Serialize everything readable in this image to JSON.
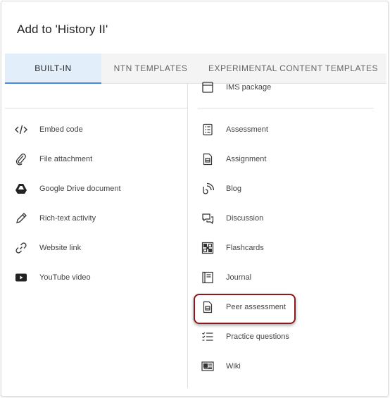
{
  "dialog": {
    "title": "Add to 'History II'"
  },
  "tabs": [
    {
      "label": "BUILT-IN",
      "active": true
    },
    {
      "label": "NTN TEMPLATES",
      "active": false
    },
    {
      "label": "EXPERIMENTAL CONTENT TEMPLATES",
      "active": false
    }
  ],
  "left_items": [
    {
      "label": "Embed code",
      "icon": "code-icon"
    },
    {
      "label": "File attachment",
      "icon": "paperclip-icon"
    },
    {
      "label": "Google Drive document",
      "icon": "google-drive-icon"
    },
    {
      "label": "Rich-text activity",
      "icon": "pencil-icon"
    },
    {
      "label": "Website link",
      "icon": "link-icon"
    },
    {
      "label": "YouTube video",
      "icon": "youtube-icon"
    }
  ],
  "right_top_item": {
    "label": "IMS package",
    "icon": "package-icon"
  },
  "right_items": [
    {
      "label": "Assessment",
      "icon": "assessment-icon"
    },
    {
      "label": "Assignment",
      "icon": "assignment-icon"
    },
    {
      "label": "Blog",
      "icon": "blog-icon"
    },
    {
      "label": "Discussion",
      "icon": "discussion-icon"
    },
    {
      "label": "Flashcards",
      "icon": "flashcards-icon"
    },
    {
      "label": "Journal",
      "icon": "journal-icon"
    },
    {
      "label": "Peer assessment",
      "icon": "peer-assessment-icon"
    },
    {
      "label": "Practice questions",
      "icon": "practice-questions-icon"
    },
    {
      "label": "Wiki",
      "icon": "wiki-icon"
    }
  ],
  "colors": {
    "active_tab_bg": "#e3eefb",
    "active_tab_underline": "#4a8ad8",
    "highlight_border": "#8b1a1a"
  }
}
